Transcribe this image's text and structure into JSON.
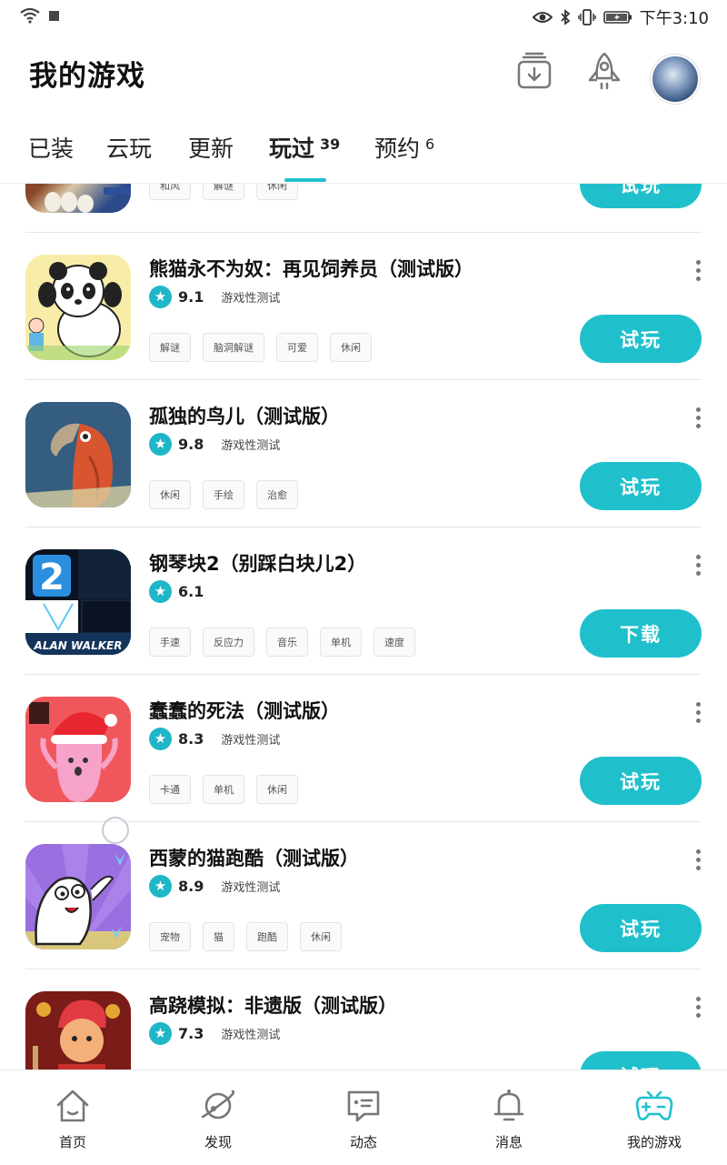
{
  "status_bar": {
    "time": "下午3:10",
    "icons": [
      "wifi-icon",
      "eye-icon",
      "bluetooth-icon",
      "vibrate-icon",
      "battery-icon"
    ]
  },
  "header": {
    "title": "我的游戏",
    "icons": [
      "download-manager-icon",
      "rocket-icon"
    ]
  },
  "tabs": [
    {
      "label": "已装",
      "count": ""
    },
    {
      "label": "云玩",
      "count": ""
    },
    {
      "label": "更新",
      "count": ""
    },
    {
      "label": "玩过",
      "count": "39",
      "active": true
    },
    {
      "label": "预约",
      "count": "6"
    }
  ],
  "games": [
    {
      "name": "",
      "score": "",
      "test_label": "",
      "tags": [
        "和风",
        "解谜",
        "休闲"
      ],
      "button": "试玩"
    },
    {
      "name": "熊猫永不为奴：再见饲养员（测试版）",
      "score": "9.1",
      "test_label": "游戏性测试",
      "tags": [
        "解谜",
        "脑洞解谜",
        "可爱",
        "休闲"
      ],
      "button": "试玩"
    },
    {
      "name": "孤独的鸟儿（测试版）",
      "score": "9.8",
      "test_label": "游戏性测试",
      "tags": [
        "休闲",
        "手绘",
        "治愈"
      ],
      "button": "试玩"
    },
    {
      "name": "钢琴块2（别踩白块儿2）",
      "score": "6.1",
      "test_label": "",
      "tags": [
        "手速",
        "反应力",
        "音乐",
        "单机",
        "速度"
      ],
      "button": "下载",
      "icon_text_big": "2",
      "icon_caption": "ALAN WALKER"
    },
    {
      "name": "蠢蠢的死法（测试版）",
      "score": "8.3",
      "test_label": "游戏性测试",
      "tags": [
        "卡通",
        "单机",
        "休闲"
      ],
      "button": "试玩"
    },
    {
      "name": "西蒙的猫跑酷（测试版）",
      "score": "8.9",
      "test_label": "游戏性测试",
      "tags": [
        "宠物",
        "猫",
        "跑酷",
        "休闲"
      ],
      "button": "试玩"
    },
    {
      "name": "高跷模拟：非遗版（测试版）",
      "score": "7.3",
      "test_label": "游戏性测试",
      "tags": [],
      "button": "试玩"
    }
  ],
  "bottom_nav": [
    {
      "label": "首页",
      "icon": "home-icon"
    },
    {
      "label": "发现",
      "icon": "planet-icon"
    },
    {
      "label": "动态",
      "icon": "chat-bubble-icon"
    },
    {
      "label": "消息",
      "icon": "bell-icon"
    },
    {
      "label": "我的游戏",
      "icon": "gamepad-icon",
      "active": true
    }
  ],
  "colors": {
    "accent": "#1fc0cc",
    "text": "#111111",
    "tag_border": "#e3e3e3"
  }
}
